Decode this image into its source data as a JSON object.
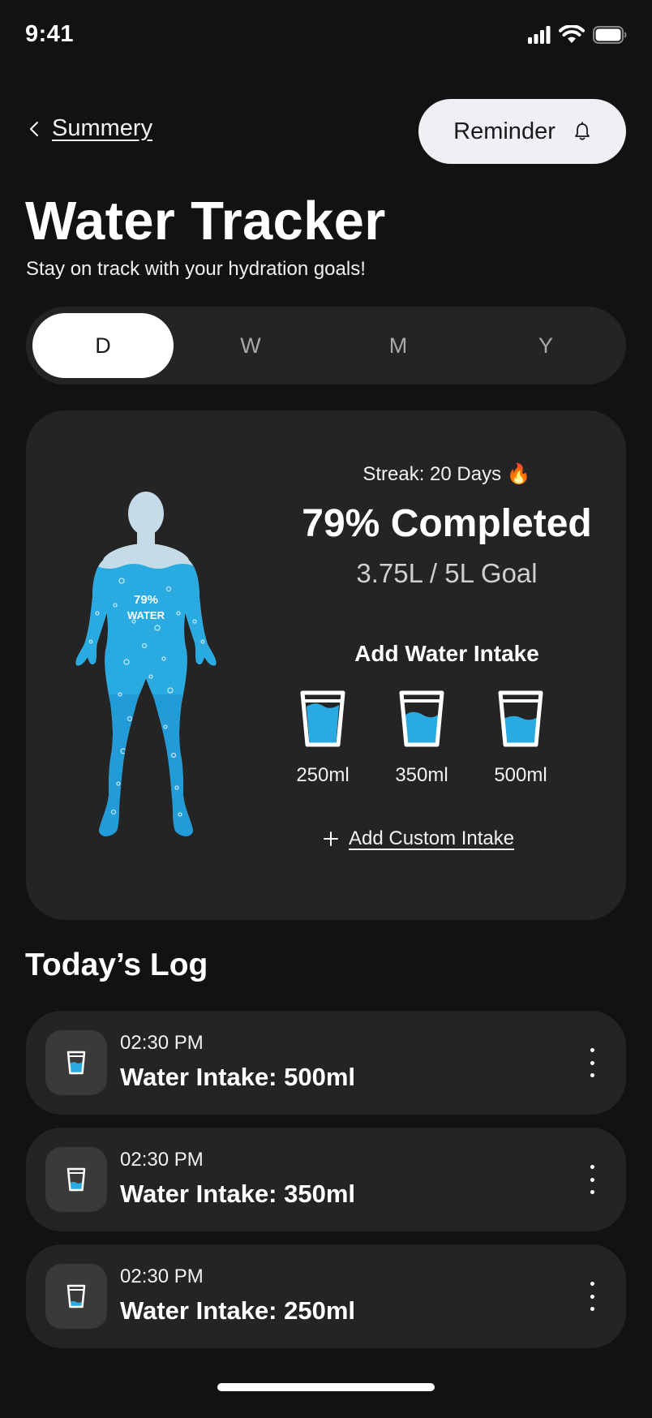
{
  "status_bar": {
    "time": "9:41",
    "icons": [
      "signal-icon",
      "wifi-icon",
      "battery-icon"
    ]
  },
  "header": {
    "back_label": "Summery",
    "reminder_label": "Reminder"
  },
  "page": {
    "title": "Water Tracker",
    "subtitle": "Stay on track with your hydration goals!"
  },
  "period_tabs": [
    {
      "label": "D",
      "active": true
    },
    {
      "label": "W",
      "active": false
    },
    {
      "label": "M",
      "active": false
    },
    {
      "label": "Y",
      "active": false
    }
  ],
  "progress": {
    "streak": "Streak: 20 Days 🔥",
    "completed_title": "79% Completed",
    "goal_text": "3.75L / 5L Goal",
    "body_percent": "79%",
    "body_label": "WATER",
    "fill_fraction": 0.79
  },
  "add_intake": {
    "heading": "Add Water Intake",
    "options": [
      {
        "label": "250ml",
        "fill_fraction": 0.45
      },
      {
        "label": "350ml",
        "fill_fraction": 0.6
      },
      {
        "label": "500ml",
        "fill_fraction": 0.8
      }
    ],
    "custom_label": "Add Custom Intake"
  },
  "log": {
    "title": "Today’s Log",
    "items": [
      {
        "time": "02:30 PM",
        "description": "Water Intake: 500ml"
      },
      {
        "time": "02:30 PM",
        "description": "Water Intake: 350ml"
      },
      {
        "time": "02:30 PM",
        "description": "Water Intake: 250ml"
      }
    ]
  },
  "colors": {
    "background": "#121212",
    "card": "#242424",
    "water": "#29ABE2",
    "water_light": "#C5DCE8",
    "accent_white": "#FFFFFF"
  }
}
